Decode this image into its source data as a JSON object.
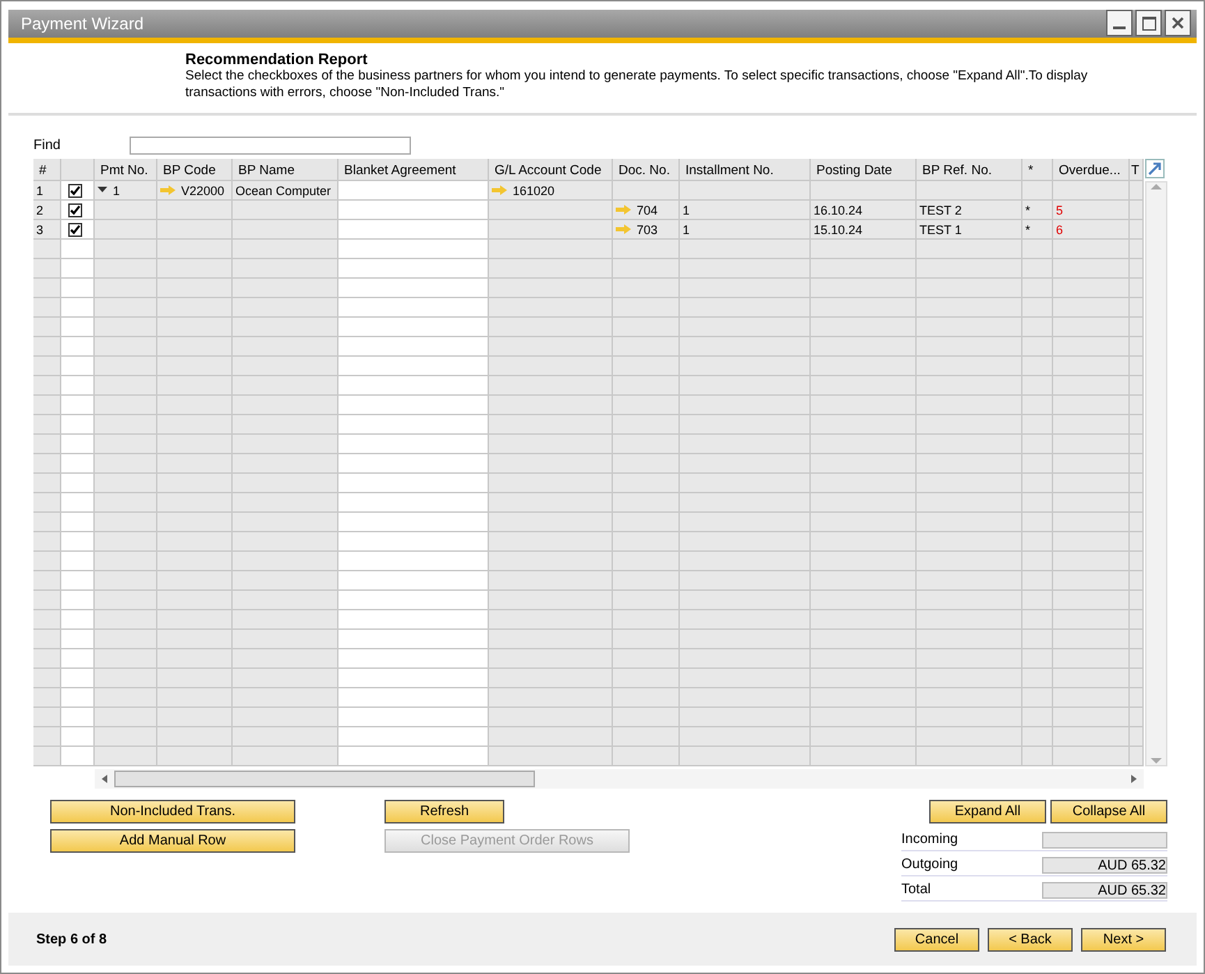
{
  "window": {
    "title": "Payment Wizard"
  },
  "header": {
    "title": "Recommendation Report",
    "description": "Select the checkboxes of the business partners for whom you intend to generate payments. To select specific transactions, choose \"Expand All\".To display transactions with errors, choose \"Non-Included Trans.\""
  },
  "find": {
    "label": "Find"
  },
  "table": {
    "columns": [
      "#",
      "",
      "Pmt No.",
      "BP Code",
      "BP Name",
      "Blanket Agreement",
      "G/L Account Code",
      "Doc. No.",
      "Installment No.",
      "Posting Date",
      "BP Ref. No.",
      "*",
      "Overdue...",
      "T"
    ],
    "rows": [
      {
        "num": "1",
        "checked": true,
        "pmt_no": "1",
        "expanded": true,
        "bp_code": "V22000",
        "bp_name": "Ocean Computer",
        "gl_account": "161020"
      },
      {
        "num": "2",
        "checked": true,
        "doc_no": "704",
        "installment": "1",
        "posting_date": "16.10.24",
        "bp_ref": "TEST 2",
        "flag": "*",
        "overdue": "5"
      },
      {
        "num": "3",
        "checked": true,
        "doc_no": "703",
        "installment": "1",
        "posting_date": "15.10.24",
        "bp_ref": "TEST 1",
        "flag": "*",
        "overdue": "6"
      }
    ]
  },
  "left_buttons": [
    {
      "label": "Non-Included Trans.",
      "disabled": false
    },
    {
      "label": "Refresh",
      "disabled": false
    },
    {
      "label": "Add Manual Row",
      "disabled": false
    },
    {
      "label": "Close Payment Order Rows",
      "disabled": true
    }
  ],
  "right_buttons": [
    {
      "label": "Expand All"
    },
    {
      "label": "Collapse All"
    }
  ],
  "totals": [
    {
      "label": "Incoming"
    },
    {
      "label": "Outgoing",
      "value": "AUD 65.32"
    },
    {
      "label": "Total",
      "value": "AUD 65.32"
    }
  ],
  "footer": {
    "step": "Step 6 of 8",
    "buttons": [
      {
        "label": "Cancel"
      },
      {
        "label": "< Back"
      },
      {
        "label": "Next >"
      }
    ]
  }
}
